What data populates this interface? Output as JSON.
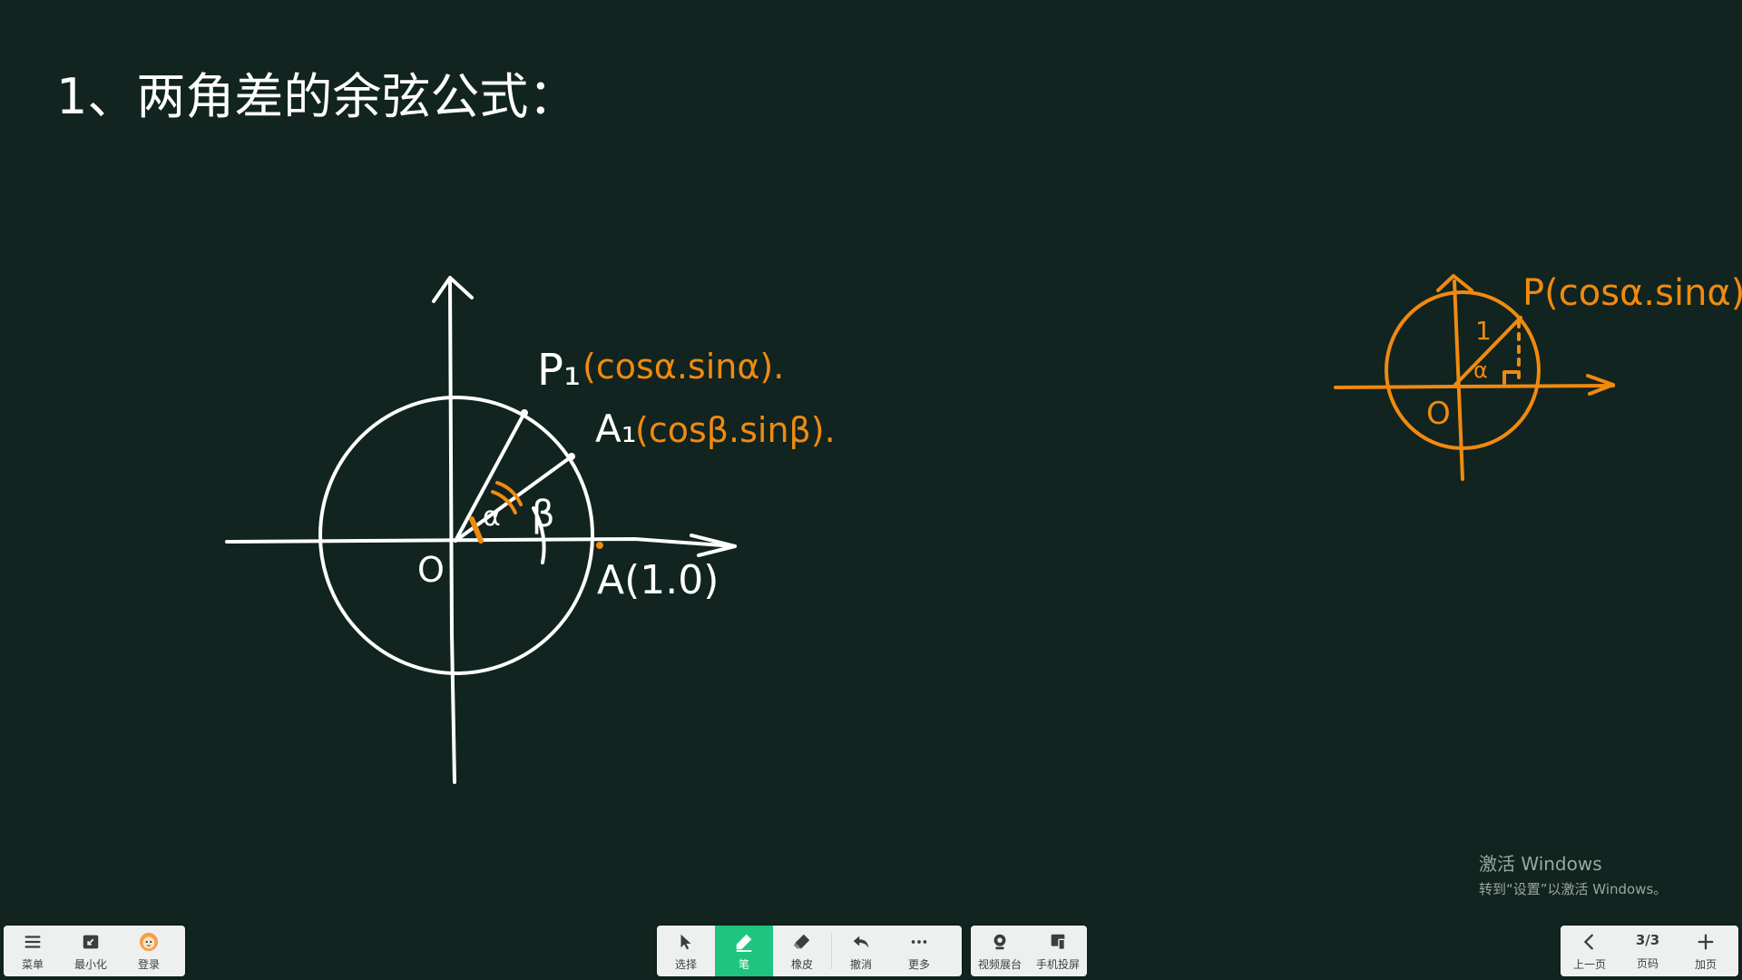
{
  "board": {
    "title_line": "1、两角差的余弦公式：",
    "label_P1": "P₁",
    "label_P1_coords": "(cosα.sinα).",
    "label_A1": "A₁",
    "label_A1_coords": "(cosβ.sinβ).",
    "label_A": "A(1.0)",
    "label_O": "O",
    "label_alpha": "α",
    "label_beta": "β",
    "small_P": "P(cosα.sinα)",
    "small_O": "O",
    "small_one": "1",
    "small_alpha": "α",
    "ink_colors": {
      "white": "#ffffff",
      "orange": "#f08a10",
      "board": "#11241f"
    }
  },
  "watermark": {
    "title": "激活 Windows",
    "subtitle": "转到“设置”以激活 Windows。"
  },
  "toolbar_left": [
    {
      "label": "菜单",
      "icon": "menu-icon"
    },
    {
      "label": "最小化",
      "icon": "minimize-icon"
    },
    {
      "label": "登录",
      "icon": "avatar-icon"
    }
  ],
  "toolbar_center": [
    {
      "label": "选择",
      "icon": "cursor-icon",
      "active": false
    },
    {
      "label": "笔",
      "icon": "pen-icon",
      "active": true
    },
    {
      "label": "橡皮",
      "icon": "eraser-icon",
      "active": false
    },
    {
      "label": "撤消",
      "icon": "undo-icon",
      "active": false
    },
    {
      "label": "更多",
      "icon": "more-icon",
      "active": false
    }
  ],
  "toolbar_media": [
    {
      "label": "视频展台",
      "icon": "camera-icon"
    },
    {
      "label": "手机投屏",
      "icon": "phone-cast-icon"
    }
  ],
  "toolbar_right": {
    "prev_label": "上一页",
    "page_current": "3/3",
    "page_label": "页码",
    "add_label": "加页"
  }
}
